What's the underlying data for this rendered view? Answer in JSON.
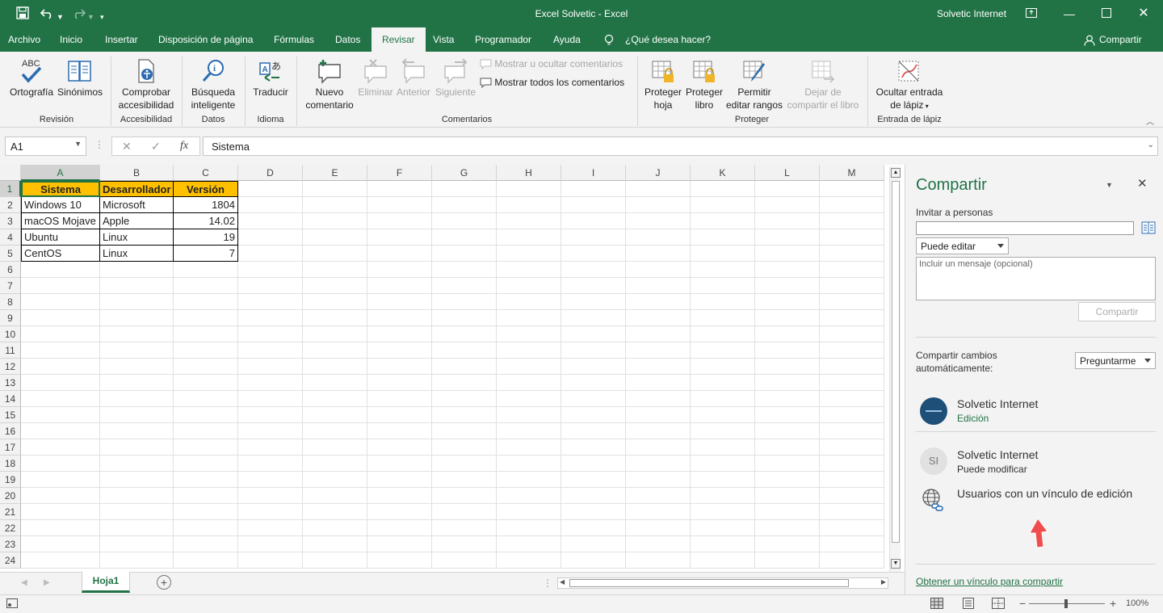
{
  "titlebar": {
    "title": "Excel Solvetic  -  Excel",
    "user": "Solvetic Internet",
    "accent": "#217346"
  },
  "menu": {
    "tabs": [
      "Archivo",
      "Inicio",
      "Insertar",
      "Disposición de página",
      "Fórmulas",
      "Datos",
      "Revisar",
      "Vista",
      "Programador",
      "Ayuda"
    ],
    "active": "Revisar",
    "tell_me": "¿Qué desea hacer?",
    "share": "Compartir"
  },
  "ribbon": {
    "ortografia": "Ortografía",
    "sinonimos": "Sinónimos",
    "abc": "ABC",
    "comprobar_1": "Comprobar",
    "comprobar_2": "accesibilidad",
    "busqueda_1": "Búsqueda",
    "busqueda_2": "inteligente",
    "traducir": "Traducir",
    "nuevo_1": "Nuevo",
    "nuevo_2": "comentario",
    "eliminar": "Eliminar",
    "anterior": "Anterior",
    "siguiente": "Siguiente",
    "mostrar_ocultar": "Mostrar u ocultar comentarios",
    "mostrar_todos": "Mostrar todos los comentarios",
    "proteger_hoja_1": "Proteger",
    "proteger_hoja_2": "hoja",
    "proteger_libro_1": "Proteger",
    "proteger_libro_2": "libro",
    "permitir_1": "Permitir",
    "permitir_2": "editar rangos",
    "dejar_1": "Dejar de",
    "dejar_2": "compartir el libro",
    "ocultar_1": "Ocultar entrada",
    "ocultar_2": "de lápiz",
    "groups": {
      "revision": "Revisión",
      "accesibilidad": "Accesibilidad",
      "datos": "Datos",
      "idioma": "Idioma",
      "comentarios": "Comentarios",
      "proteger": "Proteger",
      "lapiz": "Entrada de lápiz"
    }
  },
  "formula": {
    "namebox": "A1",
    "fx": "fx",
    "content": "Sistema"
  },
  "grid": {
    "columns": [
      "A",
      "B",
      "C",
      "D",
      "E",
      "F",
      "G",
      "H",
      "I",
      "J",
      "K",
      "L",
      "M"
    ],
    "rows": [
      "1",
      "2",
      "3",
      "4",
      "5",
      "6",
      "7",
      "8",
      "9",
      "10",
      "11",
      "12",
      "13",
      "14",
      "15",
      "16",
      "17",
      "18",
      "19",
      "20",
      "21",
      "22",
      "23",
      "24"
    ],
    "header_fill": "#ffc000",
    "table": [
      [
        "Sistema",
        "Desarrollador",
        "Versión"
      ],
      [
        "Windows 10",
        "Microsoft",
        "1804"
      ],
      [
        "macOS Mojave",
        "Apple",
        "14.02"
      ],
      [
        "Ubuntu",
        "Linux",
        "19"
      ],
      [
        "CentOS",
        "Linux",
        "7"
      ]
    ]
  },
  "sheet": {
    "tab": "Hoja1"
  },
  "status": {
    "zoom": "100%"
  },
  "pane": {
    "title": "Compartir",
    "invite_label": "Invitar a personas",
    "invite_value": "",
    "permission": "Puede editar",
    "message_placeholder": "Incluir un mensaje (opcional)",
    "share_button": "Compartir",
    "auto_label_1": "Compartir cambios",
    "auto_label_2": "automáticamente:",
    "auto_value": "Preguntarme",
    "people": [
      {
        "name": "Solvetic Internet",
        "role": "Edición"
      },
      {
        "name": "Solvetic Internet",
        "role": "Puede modificar",
        "initials": "SI"
      }
    ],
    "link_users": "Usuarios con un vínculo de edición",
    "get_link": "Obtener un vínculo para compartir",
    "link_color": "#217346"
  }
}
